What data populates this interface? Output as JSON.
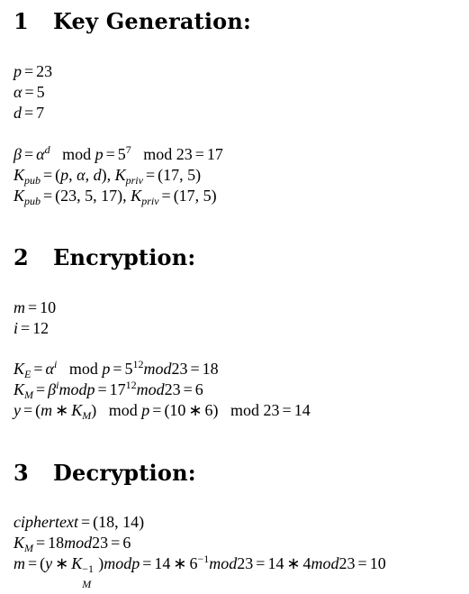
{
  "sections": [
    {
      "number": "1",
      "title": "Key Generation:"
    },
    {
      "number": "2",
      "title": "Encryption:"
    },
    {
      "number": "3",
      "title": "Decryption:"
    }
  ],
  "key_generation": {
    "p_val": "23",
    "alpha_val": "5",
    "d_val": "7",
    "beta_result": "17",
    "kpriv_val": "(17, 5)",
    "kpub_numeric": "(23, 5, 17)"
  },
  "encryption": {
    "m_val": "10",
    "i_val": "12",
    "ke_result": "18",
    "km_result": "6",
    "y_result": "14"
  },
  "decryption": {
    "ciphertext_val": "(18, 14)",
    "km_result": "6",
    "m_result": "10"
  }
}
